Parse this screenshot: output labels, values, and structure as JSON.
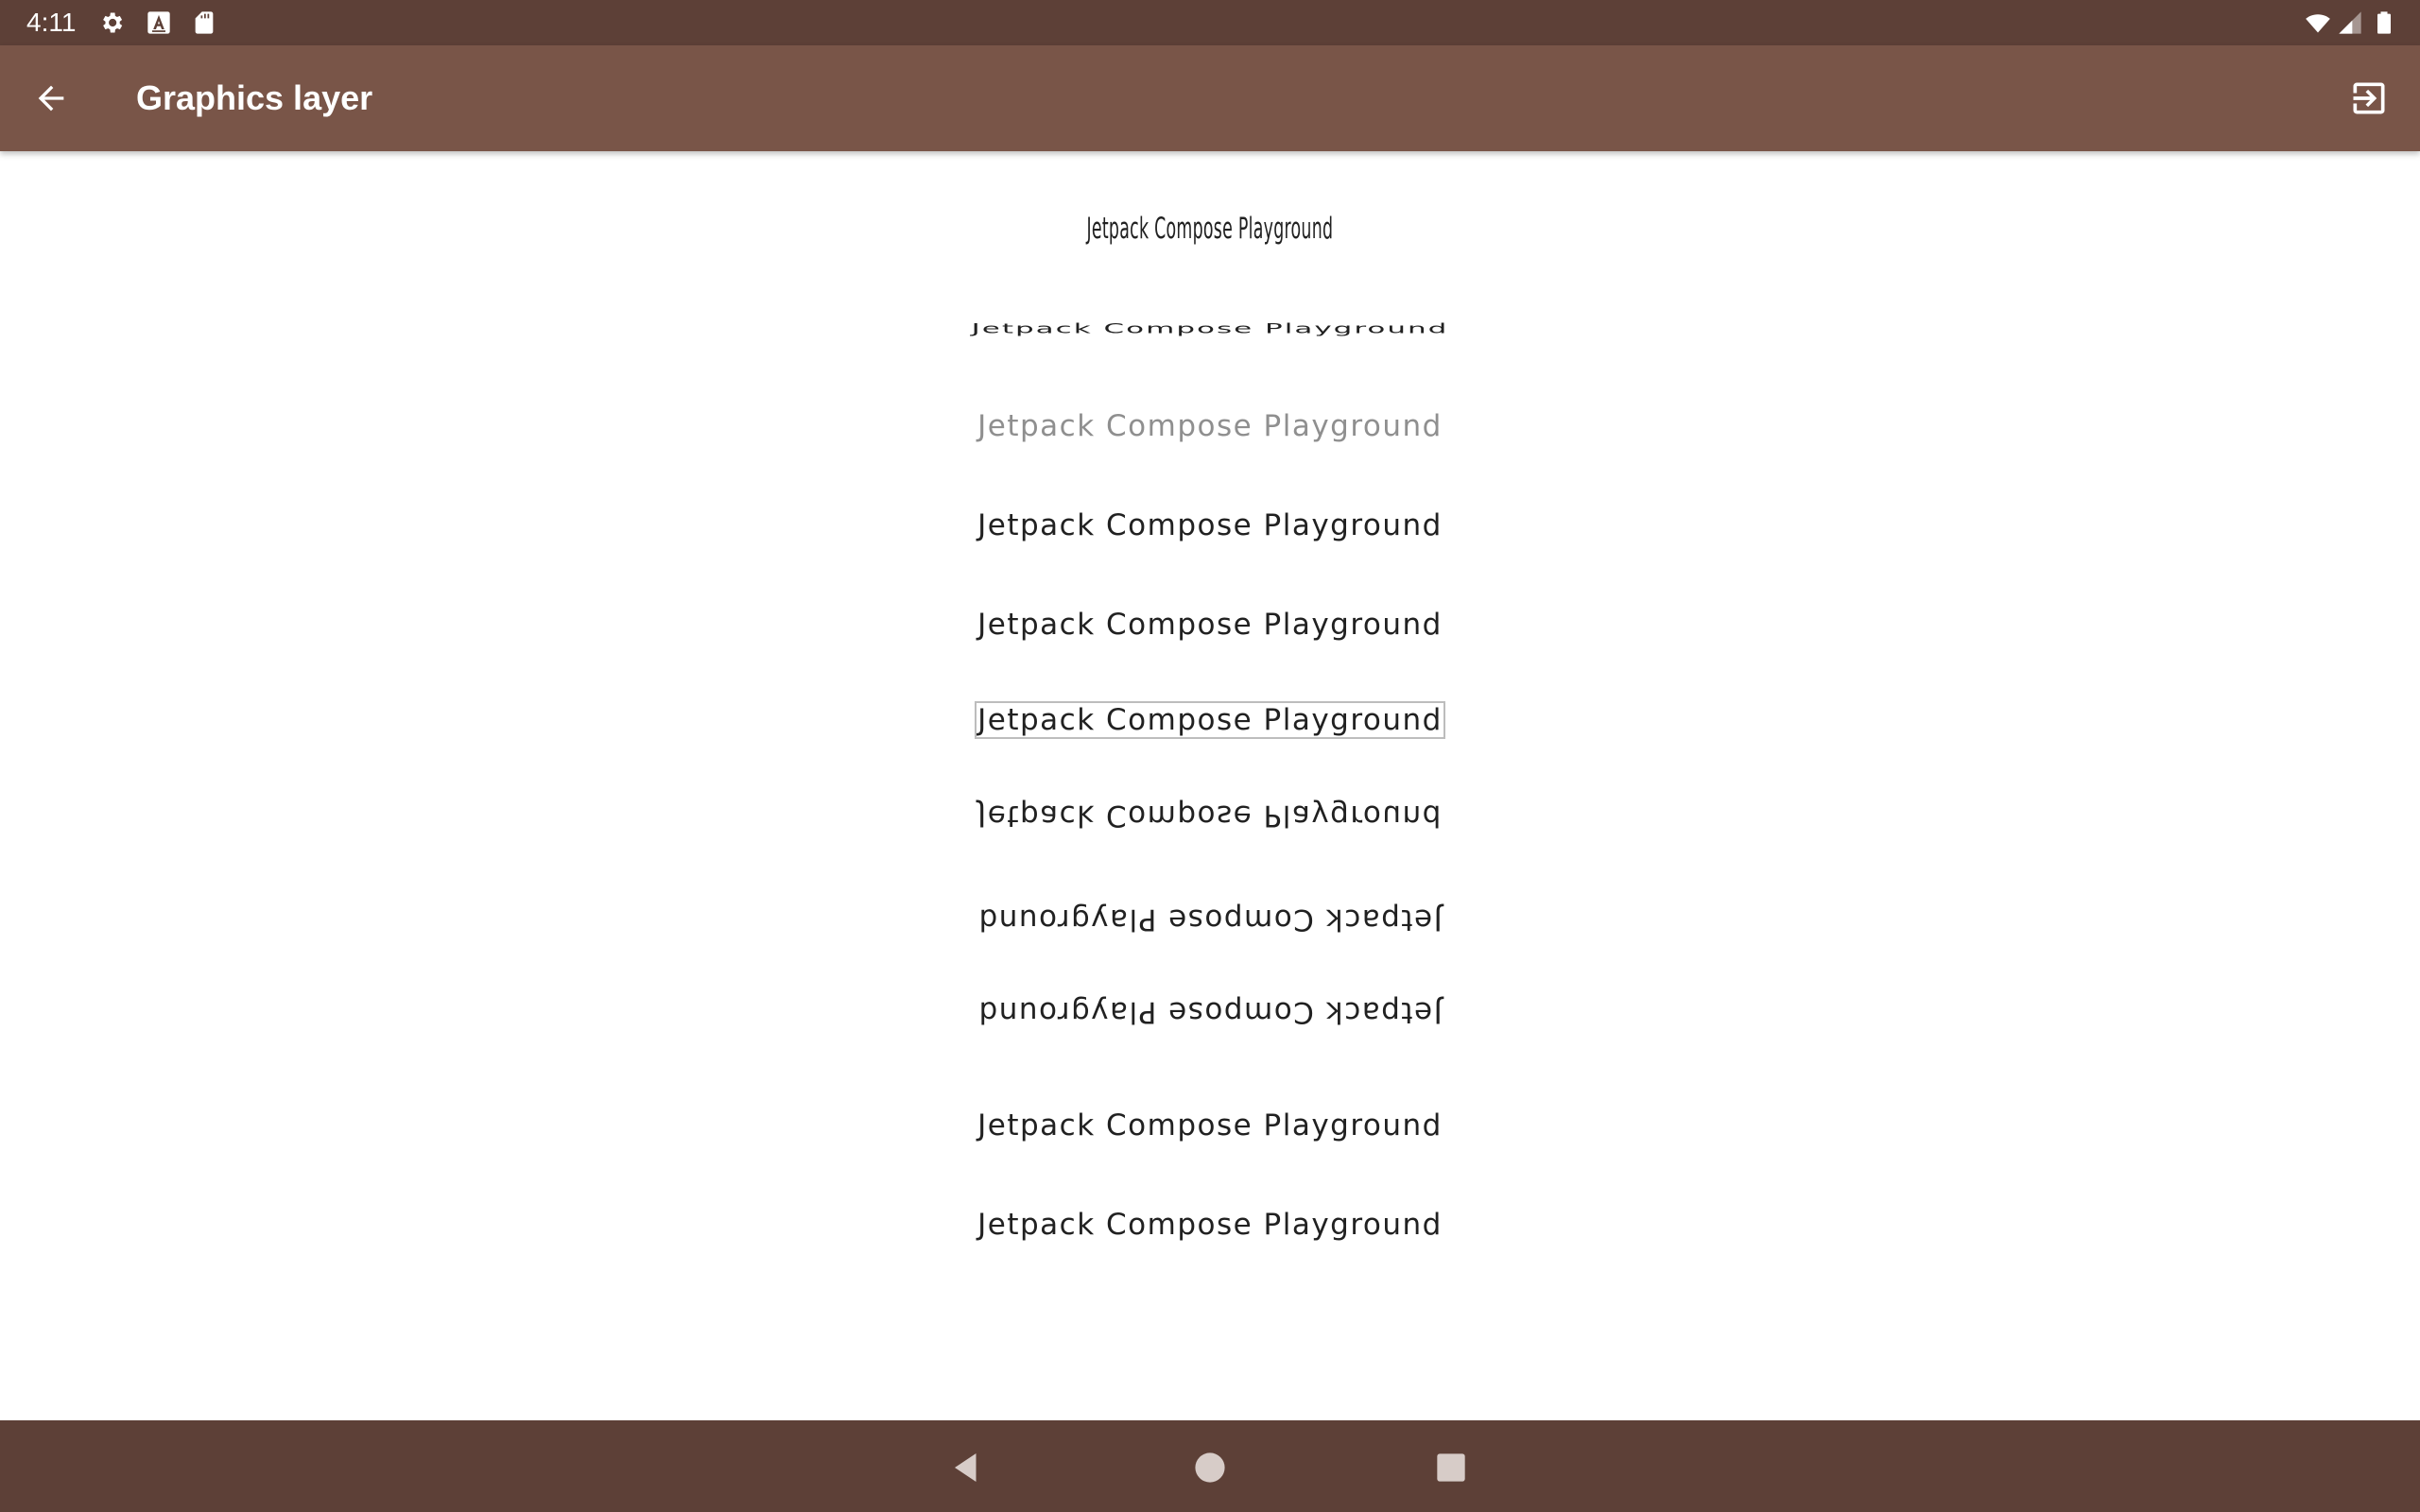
{
  "status_bar": {
    "time": "4:11",
    "left_icons": [
      "gear-icon",
      "keyboard-a-icon",
      "sd-card-icon"
    ],
    "right_icons": [
      "wifi-icon",
      "cell-signal-icon",
      "battery-icon"
    ]
  },
  "app_bar": {
    "title": "Graphics layer",
    "back_icon": "arrow-back-icon",
    "action_icon": "exit-to-app-icon"
  },
  "samples": [
    {
      "text": "Jetpack Compose Playground",
      "effect": "horizontal squeeze"
    },
    {
      "text": "Jetpack Compose Playground",
      "effect": "vertical squeeze"
    },
    {
      "text": "Jetpack Compose Playground",
      "effect": "alpha"
    },
    {
      "text": "Jetpack Compose Playground",
      "effect": "none"
    },
    {
      "text": "Jetpack Compose Playground",
      "effect": "none"
    },
    {
      "text": "Jetpack Compose Playground",
      "effect": "border"
    },
    {
      "text": "Jetpack Compose Playground",
      "effect": "flip vertical"
    },
    {
      "text": "Jetpack Compose Playground",
      "effect": "rotate 180"
    },
    {
      "text": "Jetpack Compose Playground",
      "effect": "rotate 180"
    },
    {
      "text": "Jetpack Compose Playground",
      "effect": "none"
    },
    {
      "text": "Jetpack Compose Playground",
      "effect": "none"
    }
  ],
  "nav_bar": {
    "buttons": [
      "back-triangle-icon",
      "home-circle-icon",
      "recents-square-icon"
    ]
  },
  "colors": {
    "status_bar": "#5d4037",
    "app_bar": "#795548",
    "nav_bar": "#5d4037",
    "text": "#212121"
  }
}
